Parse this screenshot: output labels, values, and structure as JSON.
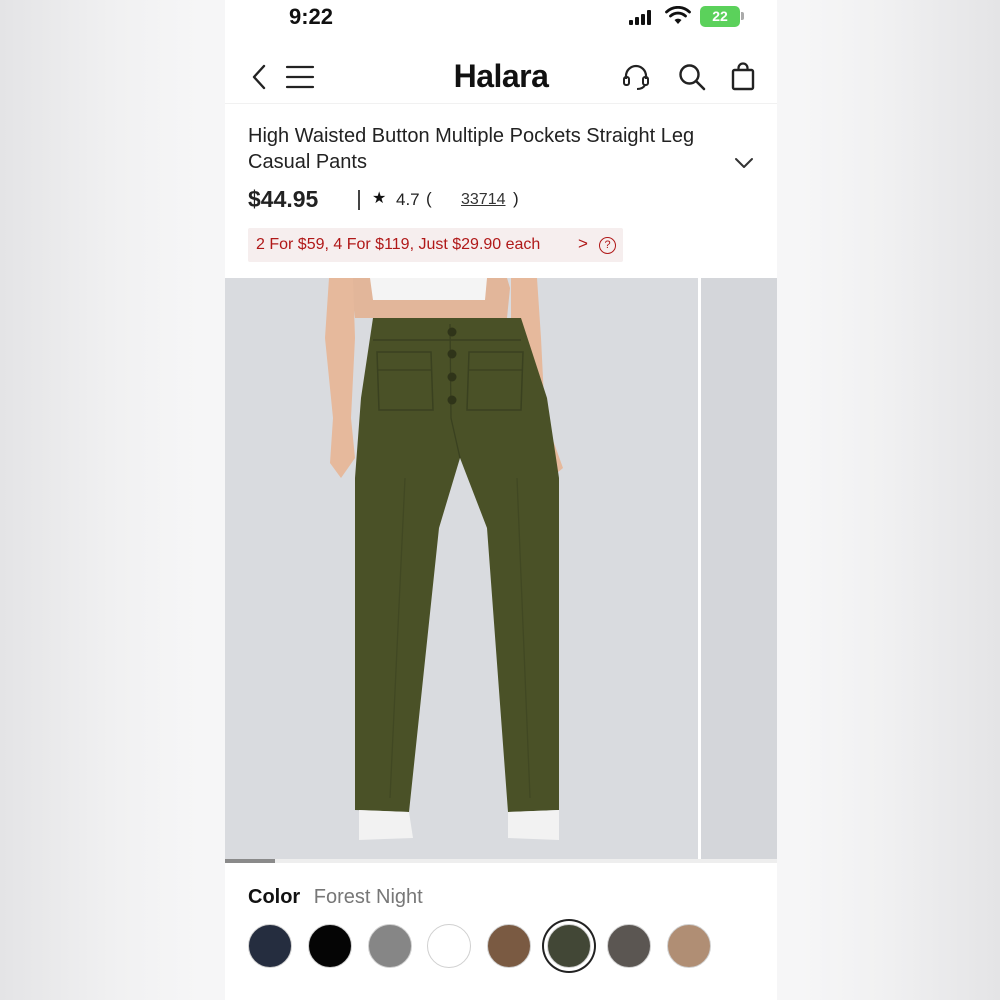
{
  "status_bar": {
    "time": "9:22",
    "battery": "22"
  },
  "header": {
    "logo": "Halara",
    "icons": [
      "back-icon",
      "menu-icon",
      "headset-icon",
      "search-icon",
      "shopping-bag-icon"
    ]
  },
  "product": {
    "title": "High Waisted Button Multiple Pockets Straight Leg Casual Pants",
    "price": "$44.95",
    "rating": "4.7",
    "reviews": "33714",
    "promo": "2 For $59, 4 For $119, Just $29.90 each"
  },
  "gallery": {
    "image_progress": 0.09,
    "pants_color": "#4a5127",
    "background_color": "#d9dbdf"
  },
  "color": {
    "label": "Color",
    "selected": "Forest Night",
    "swatches": [
      {
        "hex": "#252d3f"
      },
      {
        "hex": "#050505"
      },
      {
        "hex": "#868686"
      },
      {
        "hex": "#ffffff"
      },
      {
        "hex": "#7a5a42"
      },
      {
        "hex": "#424736",
        "selected": true
      },
      {
        "hex": "#5b5652"
      },
      {
        "hex": "#b08e74"
      }
    ]
  }
}
